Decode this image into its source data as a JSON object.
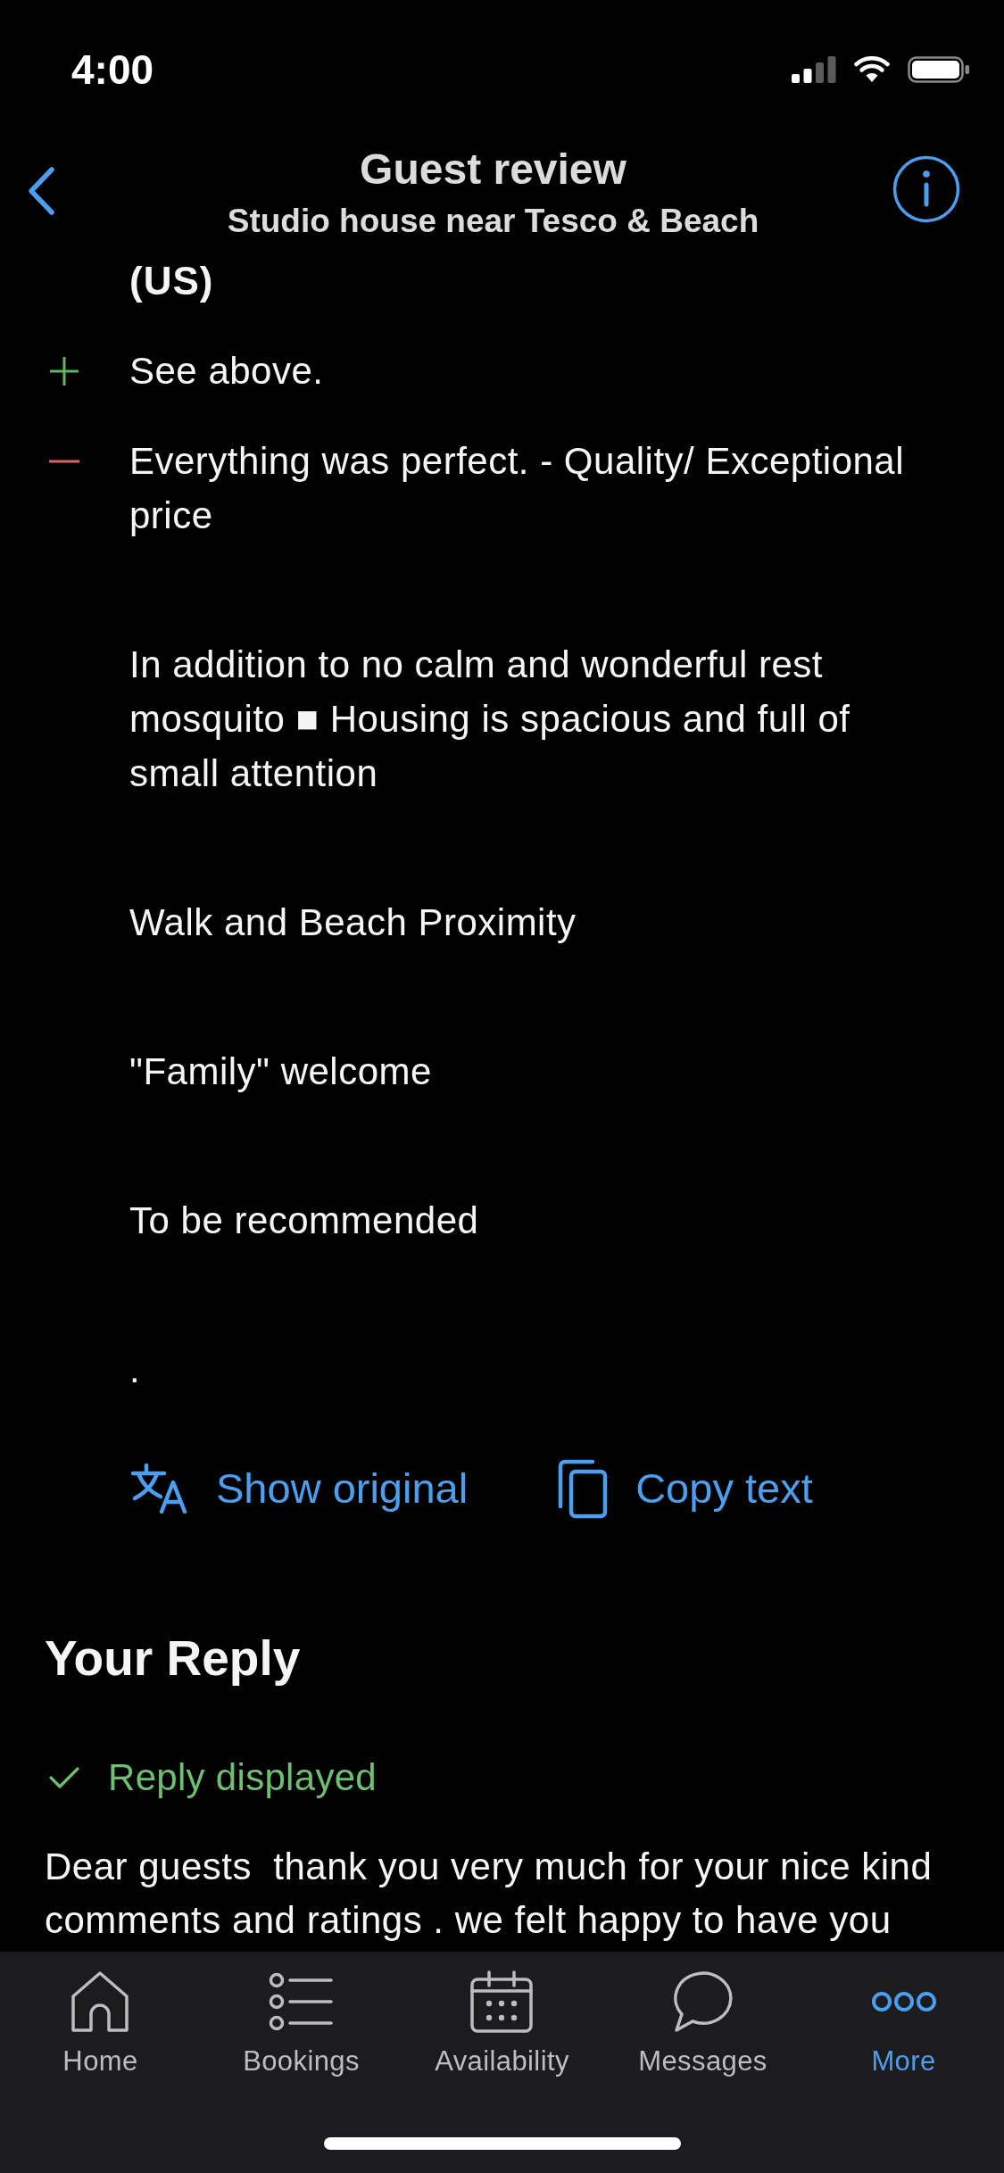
{
  "status_bar": {
    "time": "4:00"
  },
  "header": {
    "title": "Guest review",
    "subtitle": "Studio house near Tesco & Beach"
  },
  "review": {
    "reviewer": "(US)",
    "comments": [
      {
        "kind": "positive",
        "paragraphs": [
          "See above."
        ]
      },
      {
        "kind": "negative",
        "paragraphs": [
          "Everything was perfect. - Quality/ Exceptional price",
          "In addition to no calm and wonderful rest mosquito ■ Housing is spacious and full of small attention",
          "Walk and Beach Proximity",
          "\"Family\" welcome",
          "To be recommended",
          "."
        ]
      }
    ],
    "actions": [
      {
        "kind": "translate",
        "label": "Show original"
      },
      {
        "kind": "copy",
        "label": "Copy text"
      }
    ]
  },
  "reply": {
    "heading": "Your Reply",
    "status": "Reply displayed",
    "text": "Dear guests  thank you very much for your nice kind comments and ratings . we felt happy to have you"
  },
  "tab_bar": {
    "tabs": [
      {
        "kind": "home",
        "label": "Home",
        "selected": false
      },
      {
        "kind": "bookings",
        "label": "Bookings",
        "selected": false
      },
      {
        "kind": "availability",
        "label": "Availability",
        "selected": false
      },
      {
        "kind": "messages",
        "label": "Messages",
        "selected": false
      },
      {
        "kind": "more",
        "label": "More",
        "selected": true
      }
    ]
  }
}
